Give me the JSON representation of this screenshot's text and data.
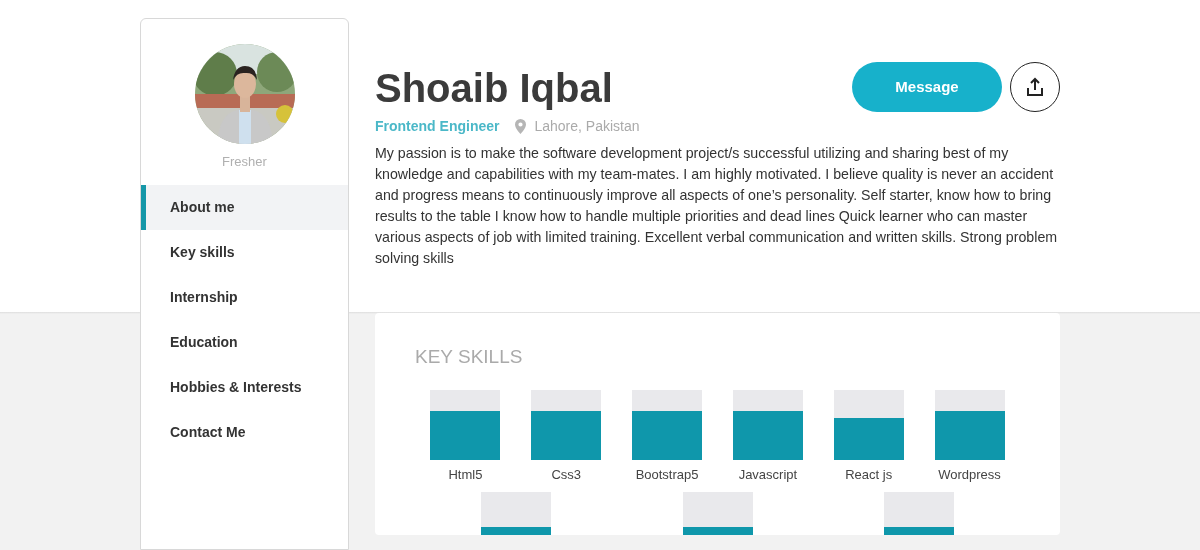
{
  "profile": {
    "status": "Fresher",
    "name": "Shoaib Iqbal",
    "role": "Frontend Engineer",
    "location": "Lahore, Pakistan",
    "about": "My passion is to make the software development project/s successful utilizing and sharing best of my knowledge and capabilities with my team-mates. I am highly motivated. I believe quality is never an accident and progress means to continuously improve all aspects of one’s personality.  Self starter, know how to bring results to the table  I know how to handle multiple priorities and dead lines  Quick learner who can master various aspects of job with limited training.  Excellent verbal communication and written skills.  Strong problem solving skills"
  },
  "buttons": {
    "message": "Message"
  },
  "sidebar": {
    "items": [
      {
        "label": "About me",
        "selected": true
      },
      {
        "label": "Key skills",
        "selected": false
      },
      {
        "label": "Internship",
        "selected": false
      },
      {
        "label": "Education",
        "selected": false
      },
      {
        "label": "Hobbies & Interests",
        "selected": false
      },
      {
        "label": "Contact Me",
        "selected": false
      }
    ]
  },
  "key_skills": {
    "title": "KEY SKILLS",
    "rows": [
      [
        {
          "kind": "labeled",
          "label": "Html5"
        },
        {
          "kind": "labeled",
          "label": "Css3"
        },
        {
          "kind": "labeled",
          "label": "Bootstrap5"
        },
        {
          "kind": "labeled",
          "label": "Javascript"
        },
        {
          "kind": "labeled",
          "label": "React js"
        },
        {
          "kind": "labeled",
          "label": "Wordpress"
        }
      ],
      [
        {
          "kind": "cut"
        },
        {
          "kind": "cut"
        },
        {
          "kind": "cut"
        }
      ]
    ]
  }
}
